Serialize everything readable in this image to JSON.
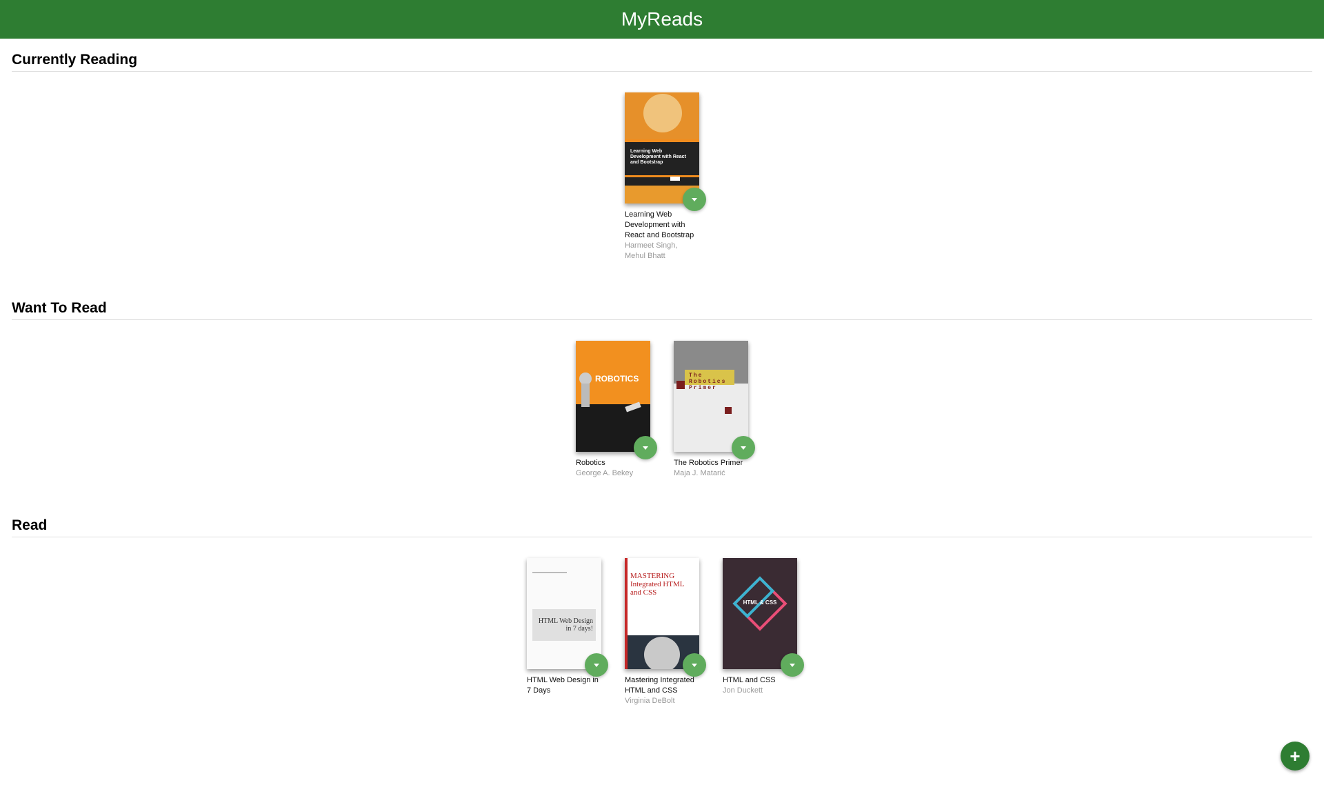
{
  "app": {
    "title": "MyReads"
  },
  "shelves": [
    {
      "title": "Currently Reading",
      "books": [
        {
          "title": "Learning Web Development with React and Bootstrap",
          "authors": "Harmeet Singh, Mehul Bhatt",
          "cover_text": "Learning Web Development with React and Bootstrap"
        }
      ]
    },
    {
      "title": "Want To Read",
      "books": [
        {
          "title": "Robotics",
          "authors": "George A. Bekey",
          "cover_text": "ROBOTICS"
        },
        {
          "title": "The Robotics Primer",
          "authors": "Maja J. Matarić",
          "cover_text": "The Robotics Primer"
        }
      ]
    },
    {
      "title": "Read",
      "books": [
        {
          "title": "HTML Web Design in 7 Days",
          "authors": "",
          "cover_text": "HTML Web Design in 7 days!"
        },
        {
          "title": "Mastering Integrated HTML and CSS",
          "authors": "Virginia DeBolt",
          "cover_text": "MASTERING Integrated HTML and CSS"
        },
        {
          "title": "HTML and CSS",
          "authors": "Jon Duckett",
          "cover_text": "HTML & CSS"
        }
      ]
    }
  ],
  "colors": {
    "header": "#2e7d32",
    "changer": "#60ac5d",
    "add_button": "#2e7d32"
  },
  "icons": {
    "shelf_changer": "caret-down-icon",
    "add_book": "plus-icon"
  },
  "add_button": {
    "symbol": "+"
  }
}
